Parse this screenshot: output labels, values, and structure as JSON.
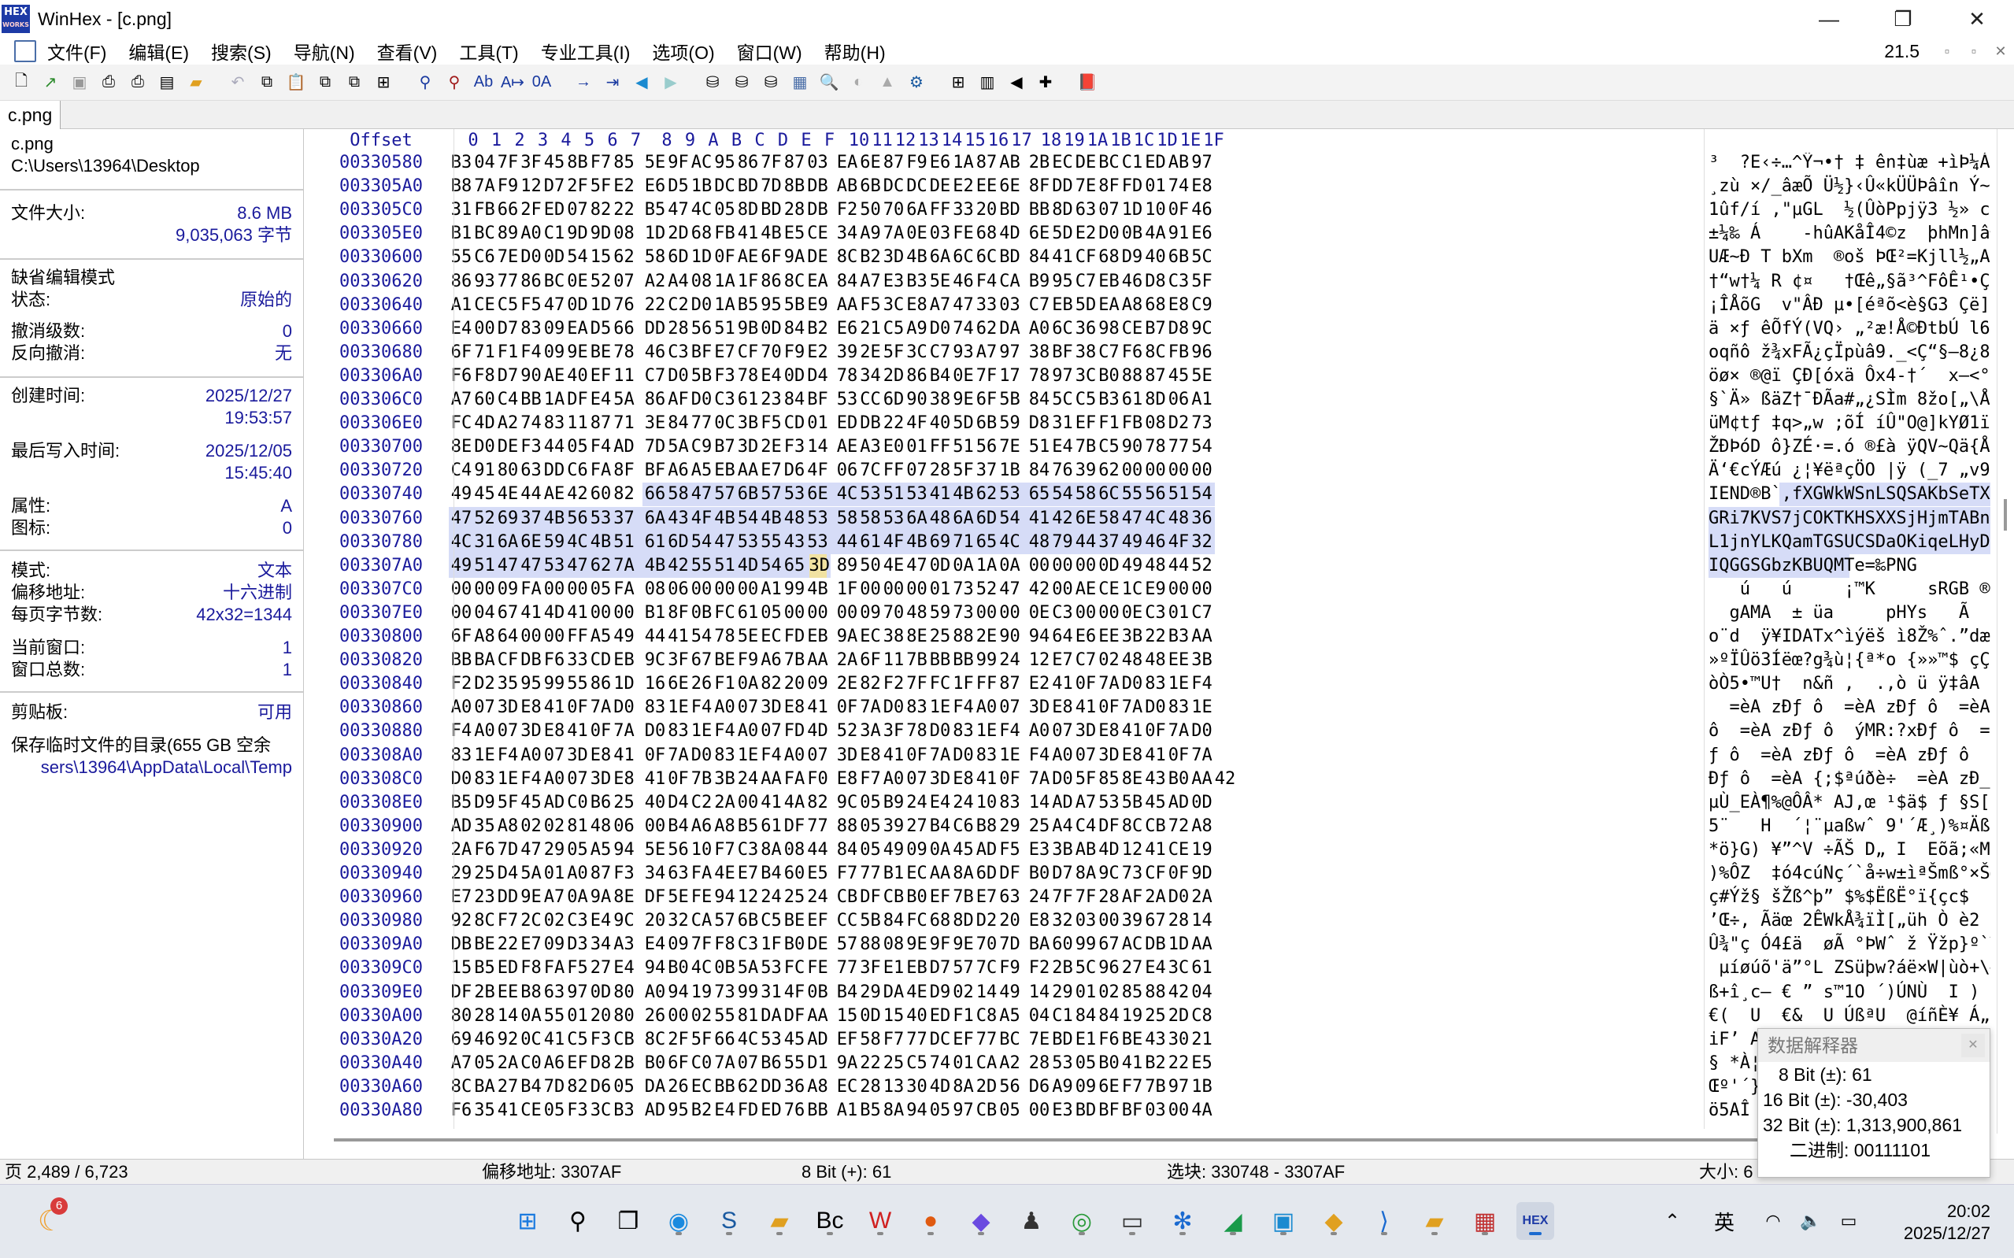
{
  "window": {
    "title": "WinHex - [c.png]",
    "tab": "c.png"
  },
  "menu": [
    "文件(F)",
    "编辑(E)",
    "搜索(S)",
    "导航(N)",
    "查看(V)",
    "工具(T)",
    "专业工具(I)",
    "选项(O)",
    "窗口(W)",
    "帮助(H)"
  ],
  "menu_right": "21.5",
  "info": {
    "file_name": "c.png",
    "path": "C:\\Users\\13964\\Desktop",
    "size_label": "文件大小:",
    "size_mb": "8.6 MB",
    "size_bytes": "9,035,063 字节",
    "edit_mode": "缺省编辑模式",
    "state_label": "状态:",
    "state": "原始的",
    "undo_label": "撤消级数:",
    "undo": "0",
    "redo_label": "反向撤消:",
    "redo": "无",
    "created_label": "创建时间:",
    "created_date": "2025/12/27",
    "created_time": "19:53:57",
    "written_label": "最后写入时间:",
    "written_date": "2025/12/05",
    "written_time": "15:45:40",
    "attr_label": "属性:",
    "attr": "A",
    "icon_label": "图标:",
    "icon": "0",
    "mode_label": "模式:",
    "mode": "文本",
    "offsets_label": "偏移地址:",
    "offsets": "十六进制",
    "bpp_label": "每页字节数:",
    "bpp": "42x32=1344",
    "curwin_label": "当前窗口:",
    "curwin": "1",
    "wincount_label": "窗口总数:",
    "wincount": "1",
    "clip_label": "剪贴板:",
    "clip": "可用",
    "temp_label": "保存临时文件的目录(655 GB 空余",
    "temp_path": "sers\\13964\\AppData\\Local\\Temp"
  },
  "hex": {
    "offset_label": "Offset",
    "columns": [
      "0",
      "1",
      "2",
      "3",
      "4",
      "5",
      "6",
      "7",
      "8",
      "9",
      "A",
      "B",
      "C",
      "D",
      "E",
      "F",
      "10",
      "11",
      "12",
      "13",
      "14",
      "15",
      "16",
      "17",
      "18",
      "19",
      "1A",
      "1B",
      "1C",
      "1D",
      "1E",
      "1F"
    ],
    "rows": [
      {
        "o": "00330580",
        "h": "B3 04 7F 3F 45 8B F7 85 5E 9F AC 95 86 7F 87 03 EA 6E 87 F9 E6 1A 87 AB 2B EC DE BC C1 ED AB 97",
        "a": "³  ?E‹÷…^Ÿ¬•† ‡ ên‡ùæ +ìÞ¼ÁíÞ«"
      },
      {
        "o": "003305A0",
        "h": "B8 7A F9 12 D7 2F 5F E2 E6 D5 1B DC BD 7D 8B DB AB 6B DC DC DE E2 EE 6E 8F DD 7E 8F FD 01 74 E8",
        "a": "¸zù ×/_âæÕ Ü½}‹Û«kÜÜÞâîn Ý~ ý tè"
      },
      {
        "o": "003305C0",
        "h": "31 FB 66 2F ED 07 82 22 B5 47 4C 05 8D BD 28 DB F2 50 70 6A FF 33 20 BD BB 8D 63 07 1D 10 0F 46",
        "a": "1ûf/í ‚\"µGL  ½(ÛòPpjÿ3 ½» c   F"
      },
      {
        "o": "003305E0",
        "h": "B1 BC 89 A0 C1 9D 9D 08 1D 2D 68 FB 41 4B E5 CE 34 A9 7A 0E 03 FE 68 4D 6E 5D E2 D0 0B 4A 91 E6",
        "a": "±¼‰ Á    -hûAKåÎ4©z  þhMn]âÐ J‘æ"
      },
      {
        "o": "00330600",
        "h": "55 C6 7E D0 0D 54 15 62 58 6D 1D 0F AE 6F 9A DE 8C B2 3D 4B 6A 6C 6C BD 84 41 CF 68 D9 40 6B 5C",
        "a": "UÆ~Ð T bXm  ®oš ÞŒ²=Kjll½„AÏhÙ@k\\"
      },
      {
        "o": "00330620",
        "h": "86 93 77 86 BC 0E 52 07 A2 A4 08 1A 1F 86 8C EA 84 A7 E3 B3 5E 46 F4 CA B9 95 C7 EB 46 D8 C3 5F",
        "a": "†“w†¼ R ¢¤   †Œê„§ã³^FôÊ¹•ÇëFØÃ_"
      },
      {
        "o": "00330640",
        "h": "A1 CE C5 F5 47 0D 1D 76 22 C2 D0 1A B5 95 5B E9 AA F5 3C E8 A7 47 33 03 C7 EB 5D EA A8 68 E8 C9",
        "a": "¡ÎÅõG  v\"ÂÐ µ•[éªõ<è§G3 Çë]ê¨hèÉ"
      },
      {
        "o": "00330660",
        "h": "E4 00 D7 83 09 EA D5 66 DD 28 56 51 9B 0D 84 B2 E6 21 C5 A9 D0 74 62 DA A0 6C 36 98 CE B7 D8 9C",
        "a": "ä ×ƒ êÕfÝ(VQ› „²æ!Å©ÐtbÚ l6˜Î·Øœ"
      },
      {
        "o": "00330680",
        "h": "6F 71 F1 F4 09 9E BE 78 46 C3 BF E7 CF 70 F9 E2 39 2E 5F 3C C7 93 A7 97 38 BF 38 C7 F6 8C FB 96",
        "a": "oqñô ž¾xFÃ¿çÏpùâ9._<Ç“§—8¿8ÇöŒû–"
      },
      {
        "o": "003306A0",
        "h": "F6 F8 D7 90 AE 40 EF 11 C7 D0 5B F3 78 E4 0D D4 78 34 2D 86 B4 0E 7F 17 78 97 3C B0 88 87 45 5E",
        "a": "öø× ®@ï ÇÐ[óxä Ôx4-†´  x—<°ˆ‡E^"
      },
      {
        "o": "003306C0",
        "h": "A7 60 C4 BB 1A DF E4 5A 86 AF D0 C3 61 23 84 BF 53 CC 6D 90 38 9E 6F 5B 84 5C C5 B3 61 8D 06 A1",
        "a": "§`Ä» ßäZ†¯ÐÃa#„¿SÌm 8žo[„\\Å³a  ¡"
      },
      {
        "o": "003306E0",
        "h": "FC 4D A2 74 83 11 87 71 3E 84 77 0C 3B F5 CD 01 ED DB 22 4F 40 5D 6B 59 D8 31 EF F1 FB 08 D2 73",
        "a": "üM¢tƒ ‡q>„w ;õÍ íÛ\"O@]kYØ1ïñû Òs"
      },
      {
        "o": "00330700",
        "h": "8E D0 DE F3 44 05 F4 AD 7D 5A C9 B7 3D 2E F3 14 AE A3 E0 01 FF 51 56 7E 51 E4 7B C5 90 78 77 54",
        "a": "ŽÐÞóD ô­}ZÉ·=.ó ®£à ÿQV~Qä{Å xwT"
      },
      {
        "o": "00330720",
        "h": "C4 91 80 63 DD C6 FA 8F BF A6 A5 EB AA E7 D6 4F 06 7C FF 07 28 5F 37 1B 84 76 39 62 00 00 00 00",
        "a": "Ä‘€cÝÆú ¿¦¥ëªçÖO |ÿ (_7 „v9b    "
      },
      {
        "o": "00330740",
        "h": "49 45 4E 44 AE 42 60 82 66 58 47 57 6B 57 53 6E 4C 53 51 53 41 4B 62 53 65 54 58 6C 55 56 51 54",
        "a": "IEND®B`‚fXGWkWSnLSQSAKbSeTXlUVQT"
      },
      {
        "o": "00330760",
        "h": "47 52 69 37 4B 56 53 37 6A 43 4F 4B 54 4B 48 53 58 58 53 6A 48 6A 6D 54 41 42 6E 58 47 4C 48 36",
        "a": "GRi7KVS7jCOKTKHSXXSjHjmTABnXGLH6"
      },
      {
        "o": "00330780",
        "h": "4C 31 6A 6E 59 4C 4B 51 61 6D 54 47 53 55 43 53 44 61 4F 4B 69 71 65 4C 48 79 44 37 49 46 4F 32",
        "a": "L1jnYLKQamTGSUCSDaOKiqeLHyD7IFO2"
      },
      {
        "o": "003307A0",
        "h": "49 51 47 47 53 47 62 7A 4B 42 55 51 4D 54 65 3D 89 50 4E 47 0D 0A 1A 0A 00 00 00 0D 49 48 44 52",
        "a": "IQGGSGbzKBUQMTe=‰PNG        IHDR"
      },
      {
        "o": "003307C0",
        "h": "00 00 09 FA 00 00 05 FA 08 06 00 00 00 A1 99 4B 1F 00 00 00 01 73 52 47 42 00 AE CE 1C E9 00 00",
        "a": "   ú   ú     ¡™K     sRGB ®Î é  "
      },
      {
        "o": "003307E0",
        "h": "00 04 67 41 4D 41 00 00 B1 8F 0B FC 61 05 00 00 00 09 70 48 59 73 00 00 0E C3 00 00 0E C3 01 C7",
        "a": "  gAMA  ± üa     pHYs   Ã   Ã Ç"
      },
      {
        "o": "00330800",
        "h": "6F A8 64 00 00 FF A5 49 44 41 54 78 5E EC FD EB 9A EC 38 8E 25 88 2E 90 94 64 E6 EE 3B 22 B3 AA",
        "a": "o¨d  ÿ¥IDATx^ìýëš ì8Ž%ˆ.”dæî;\"³ª"
      },
      {
        "o": "00330820",
        "h": "BB BA CF DB F6 33 CD EB 9C 3F 67 BE F9 A6 7B AA 2A 6F 11 7B BB BB 99 24 12 E7 C7 02 48 48 EE 3B",
        "a": "»ºÏÛö3Íëœ?g¾ù¦{ª*o {»»™$ çÇ HHî;"
      },
      {
        "o": "00330840",
        "h": "F2 D2 35 95 99 55 86 1D 16 6E 26 F1 0A 82 20 09 2E 82 F2 7F FC 1F FF 87 E2 41 0F 7A D0 83 1E F4",
        "a": "òÒ5•™U†  n&ñ ‚  .‚ò ü ÿ‡âA zÐƒ ô"
      },
      {
        "o": "00330860",
        "h": "A0 07 3D E8 41 0F 7A D0 83 1E F4 A0 07 3D E8 41 0F 7A D0 83 1E F4 A0 07 3D E8 41 0F 7A D0 83 1E",
        "a": "  =èA zÐƒ ô  =èA zÐƒ ô  =èA zÐƒ "
      },
      {
        "o": "00330880",
        "h": "F4 A0 07 3D E8 41 0F 7A D0 83 1E F4 A0 07 FD 4D 52 3A 3F 78 D0 83 1E F4 A0 07 3D E8 41 0F 7A D0",
        "a": "ô  =èA zÐƒ ô  ýMR:?xÐƒ ô  =èA zÐ"
      },
      {
        "o": "003308A0",
        "h": "83 1E F4 A0 07 3D E8 41 0F 7A D0 83 1E F4 A0 07 3D E8 41 0F 7A D0 83 1E F4 A0 07 3D E8 41 0F 7A",
        "a": "ƒ ô  =èA zÐƒ ô  =èA zÐƒ ô  =èA z"
      },
      {
        "o": "003308C0",
        "h": "D0 83 1E F4 A0 07 3D E8 41 0F 7B 3B 24 AA FA F0 E8 F7 A0 07 3D E8 41 0F 7A D0 5F 85 8E 43 B0 AA 42",
        "a": "Ðƒ ô  =èA {;$ªúðè÷  =èA zÐ_…ŽC°ªB"
      },
      {
        "o": "003308E0",
        "h": "B5 D9 5F 45 AD C0 B6 25 40 D4 C2 2A 00 41 4A 82 9C 05 B9 24 E4 24 10 83 14 AD A7 53 5B 45 AD 0D",
        "a": "µÙ_E­À¶%@ÔÂ* AJ‚œ ¹$ä$ ƒ ­§S[E­ "
      },
      {
        "o": "00330900",
        "h": "AD 35 A8 02 02 81 48 06 00 B4 A6 A8 B5 61 DF 77 88 05 39 27 B4 C6 B8 29 25 A4 C4 DF 8C CB 72 A8",
        "a": "­5¨   H  ´¦¨µaßwˆ 9'´Æ¸)%¤ÄßŒËr¨"
      },
      {
        "o": "00330920",
        "h": "2A F6 7D 47 29 05 A5 94 5E 56 10 F7 C3 8A 08 44 84 05 49 09 0A 45 AD F5 E3 3B AB 4D 12 41 CE 19",
        "a": "*ö}G) ¥”^V ÷ÃŠ D„ I  E­õã;«M AÎ "
      },
      {
        "o": "00330940",
        "h": "29 25 D4 5A 01 A0 87 F3 34 63 FA 4E E7 B4 60 E5 F7 77 B1 EC AA 8A 6D DF B0 D7 8A 9C 73 CF 0F 9D",
        "a": ")%ÔZ  ‡ó4cúNç´`å÷w±ìªŠmß°×ŠœsÏ  "
      },
      {
        "o": "00330960",
        "h": "E7 23 DD 9E A7 0A 9A 8E DF 5E FE 94 12 24 25 24 CB DF CB B0 EF 7B E7 63 24 7F 7F 28 AF 2A D0 2A",
        "a": "ç#Ýž§ šŽß^þ” $%$ËßË°ï{çc$  (¯*Ð*"
      },
      {
        "o": "00330980",
        "h": "92 8C F7 2C 02 C3 E4 9C 20 32 CA 57 6B C5 BE EF CC 5B 84 FC 68 8D D2 20 E8 32 03 00 39 67 28 14",
        "a": "’Œ÷, Ãäœ 2ÊWkÅ¾ïÌ[„üh Ò è2  9g( "
      },
      {
        "o": "003309A0",
        "h": "DB BE 22 E7 09 D3 34 A3 E4 09 7F F8 C3 1F B0 DE 57 88 08 9E 9F 9E 70 7D BA 60 99 67 AC DB 1D AA",
        "a": "Û¾\"ç Ó4£ä  øÃ °ÞWˆ ž Ÿžp}º`™g¬Û ª"
      },
      {
        "o": "003309C0",
        "h": "15 B5 ED F8 FA F5 27 E4 94 B0 4C 0B 5A 53 FC FE 77 3F E1 EB D7 57 7C F9 F2 2B 5C 96 27 E4 3C 61",
        "a": " µíøúõ'ä”°L ZSüþw?áë×W|ùò+\\–'ä<a"
      },
      {
        "o": "003309E0",
        "h": "DF 2B EE B8 63 97 0D 80 A0 94 19 73 99 31 4F 0B B4 29 DA 4E D9 02 14 49 14 29 01 02 85 88 42 04",
        "a": "ß+î¸c— € ” s™1O ´)ÚNÙ  I )  …ˆB "
      },
      {
        "o": "00330A00",
        "h": "80 28 14 0A 55 01 20 80 26 00 02 55 81 DA DF AA 15 0D 15 40 ED F1 C8 A5 04 C1 84 84 19 25 2D C8",
        "a": "€(  U  €&  U ÚßªU  @íñÈ¥ Á„„ %-È"
      },
      {
        "o": "00330A20",
        "h": "69 46 92 0C 41 C5 F3 CB 8C 2F 5F 66 4C 53 45 AD EF 58 F7 77 DC EF 77 BC 7E BD E1 F6 BE 43 30 21",
        "a": "iF’ AÅóËŒ/_fLSE­ïX÷wÜïw¼~½áö¾C0!"
      },
      {
        "o": "00330A40",
        "h": "A7 05 2A C0 A6 EF D8 2B B0 6F C0 7A 07 B6 55 D1 9A 22 25 C5 74 01 CA A2 28 53 05 B0 41 B2 22 E5",
        "a": "§ *À¦ïØ+°oÀz ¶UÑš\"%Åt Ê¢(S °A²\"å"
      },
      {
        "o": "00330A60",
        "h": "8C BA 27 B4 7D 82 D6 05 DA 26 EC BB 62 DD 36 A8 EC 28 13 30 4D 8A 2D 56 D6 A9 09 6E F7 7B 97 1B",
        "a": "Œº'´}‚Ö Ú&ì»bÝ6¨ì( 0MŠ-VÖ© n÷{— "
      },
      {
        "o": "00330A80",
        "h": "F6 35 41 CE 05 F3 3C B3 AD 95 B2 E4 FD ED 76 BB A1 B5 8A 94 05 97 CB 05 00 E3 BD BF BF 03 00 4A",
        "a": "ö5AÎ ó<³­•²äýív»¡µŠ” —Ë  ã½¿¿  J"
      }
    ]
  },
  "status": {
    "page": "页 2,489 / 6,723",
    "offset": "偏移地址: 3307AF",
    "value": "8 Bit (+): 61",
    "block": "选块: 330748 - 3307AF",
    "size": "大小: 6"
  },
  "interpreter": {
    "title": "数据解释器",
    "b8": "8 Bit (±): 61",
    "b16": "16 Bit (±): -30,403",
    "b32": "32 Bit (±): 1,313,900,861",
    "bin": "二进制: 00111101"
  },
  "taskbar": {
    "badge": "6",
    "lang": "英",
    "time": "20:02",
    "date": "2025/12/27"
  },
  "colors": {
    "accent": "#1a1a9c",
    "selection": "#d6dcf7",
    "cursor": "#3d5ad1"
  }
}
